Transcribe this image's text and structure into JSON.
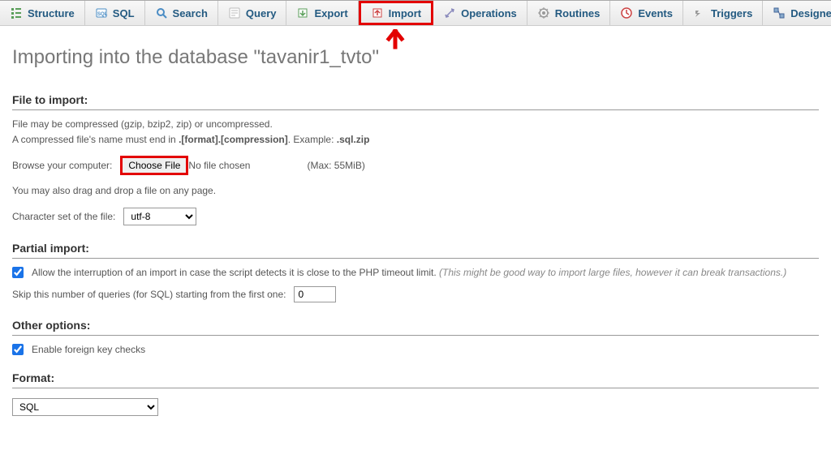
{
  "tabs": {
    "structure": "Structure",
    "sql": "SQL",
    "search": "Search",
    "query": "Query",
    "export": "Export",
    "import": "Import",
    "operations": "Operations",
    "routines": "Routines",
    "events": "Events",
    "triggers": "Triggers",
    "designer": "Designer"
  },
  "page": {
    "title": "Importing into the database \"tavanir1_tvto\""
  },
  "file": {
    "section_title": "File to import:",
    "help1": "File may be compressed (gzip, bzip2, zip) or uncompressed.",
    "help2_prefix": "A compressed file's name must end in ",
    "help2_bold": ".[format].[compression]",
    "help2_mid": ". Example: ",
    "help2_example": ".sql.zip",
    "browse_label": "Browse your computer:",
    "choose_file": "Choose File",
    "no_file": "No file chosen",
    "max": "(Max: 55MiB)",
    "drag_drop": "You may also drag and drop a file on any page.",
    "charset_label": "Character set of the file:",
    "charset_value": "utf-8"
  },
  "partial": {
    "section_title": "Partial import:",
    "allow_label": "Allow the interruption of an import in case the script detects it is close to the PHP timeout limit. ",
    "allow_note": "(This might be good way to import large files, however it can break transactions.)",
    "skip_label": "Skip this number of queries (for SQL) starting from the first one:",
    "skip_value": "0"
  },
  "other": {
    "section_title": "Other options:",
    "fk_label": "Enable foreign key checks"
  },
  "format": {
    "section_title": "Format:",
    "value": "SQL"
  }
}
